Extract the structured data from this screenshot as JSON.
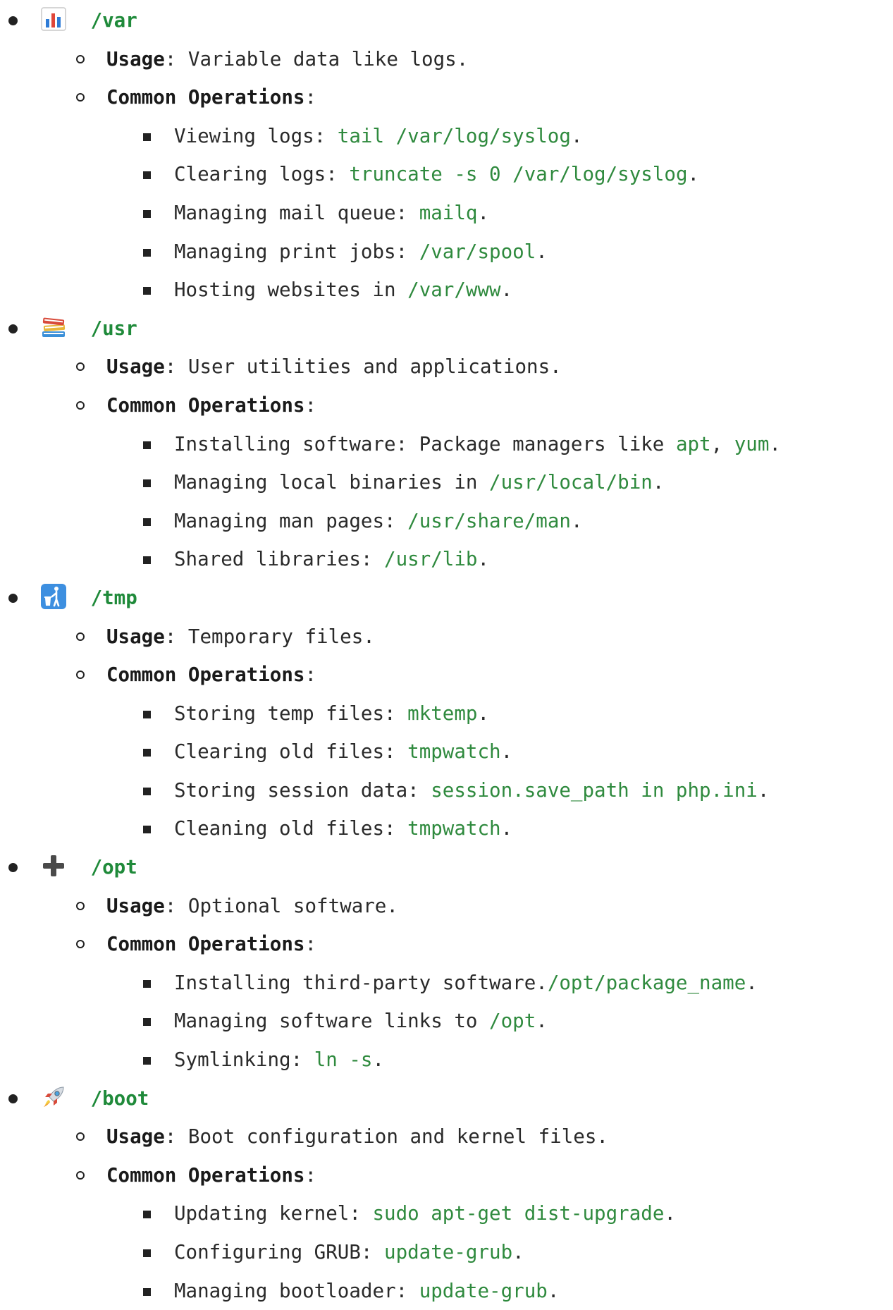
{
  "sections": [
    {
      "icon": "bar-chart-icon",
      "dir": "/var",
      "usage_label": "Usage",
      "usage_text": ": Variable data like logs.",
      "ops_label": "Common Operations",
      "ops_colon": ":",
      "ops": [
        {
          "text": "Viewing logs: ",
          "code": "tail /var/log/syslog",
          "end": "."
        },
        {
          "text": "Clearing logs: ",
          "code": "truncate -s 0 /var/log/syslog",
          "end": "."
        },
        {
          "text": "Managing mail queue: ",
          "code": "mailq",
          "end": "."
        },
        {
          "text": "Managing print jobs: ",
          "code": "/var/spool",
          "end": "."
        },
        {
          "text": "Hosting websites in ",
          "code": "/var/www",
          "end": "."
        }
      ]
    },
    {
      "icon": "books-icon",
      "dir": "/usr",
      "usage_label": "Usage",
      "usage_text": ": User utilities and applications.",
      "ops_label": "Common Operations",
      "ops_colon": ":",
      "ops": [
        {
          "text": "Installing software: Package managers like ",
          "code": "apt",
          "mid": ", ",
          "code2": "yum",
          "end": "."
        },
        {
          "text": "Managing local binaries in ",
          "code": "/usr/local/bin",
          "end": "."
        },
        {
          "text": "Managing man pages: ",
          "code": "/usr/share/man",
          "end": "."
        },
        {
          "text": "Shared libraries: ",
          "code": "/usr/lib",
          "end": "."
        }
      ]
    },
    {
      "icon": "trash-person-icon",
      "dir": "/tmp",
      "usage_label": "Usage",
      "usage_text": ": Temporary files.",
      "ops_label": "Common Operations",
      "ops_colon": ":",
      "ops": [
        {
          "text": "Storing temp files: ",
          "code": "mktemp",
          "end": "."
        },
        {
          "text": "Clearing old files: ",
          "code": "tmpwatch",
          "end": "."
        },
        {
          "text": "Storing session data: ",
          "code": "session.save_path in php.ini",
          "end": "."
        },
        {
          "text": "Cleaning old files: ",
          "code": "tmpwatch",
          "end": "."
        }
      ]
    },
    {
      "icon": "plus-icon",
      "dir": "/opt",
      "usage_label": "Usage",
      "usage_text": ": Optional software.",
      "ops_label": "Common Operations",
      "ops_colon": ":",
      "ops": [
        {
          "text": "Installing third-party software.",
          "code": "/opt/package_name",
          "end": "."
        },
        {
          "text": "Managing software links to ",
          "code": "/opt",
          "end": "."
        },
        {
          "text": "Symlinking: ",
          "code": "ln -s",
          "end": "."
        }
      ]
    },
    {
      "icon": "rocket-icon",
      "dir": "/boot",
      "usage_label": "Usage",
      "usage_text": ": Boot configuration and kernel files.",
      "ops_label": "Common Operations",
      "ops_colon": ":",
      "ops": [
        {
          "text": "Updating kernel: ",
          "code": "sudo apt-get dist-upgrade",
          "end": "."
        },
        {
          "text": "Configuring GRUB: ",
          "code": "update-grub",
          "end": "."
        },
        {
          "text": "Managing bootloader: ",
          "code": "update-grub",
          "end": "."
        }
      ]
    }
  ]
}
